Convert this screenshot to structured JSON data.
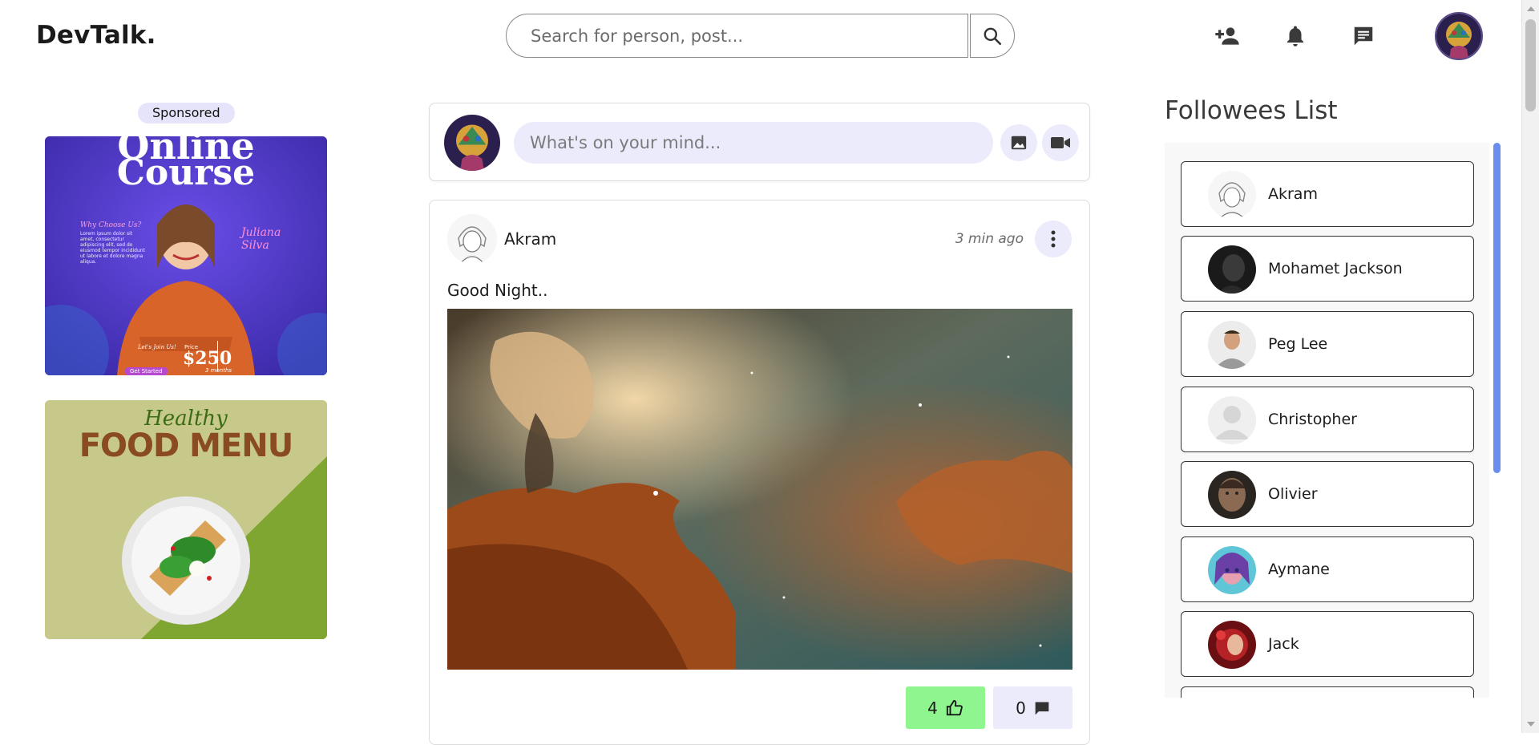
{
  "header": {
    "logo": "DevTalk.",
    "search_placeholder": "Search for person, post...",
    "icons": [
      "search-icon",
      "add-person-icon",
      "bell-icon",
      "chat-icon"
    ]
  },
  "ads": {
    "sponsored_label": "Sponsored",
    "ad1": {
      "headline1": "Online",
      "headline2": "Course",
      "why": "Why Choose Us?",
      "blurb": "Lorem ipsum dolor sit amet, consectetur adipiscing elit, sed do eiusmod tempor incididunt ut labore et dolore magna aliqua.",
      "name1": "Juliana",
      "name2": "Silva",
      "join": "Let's Join Us!",
      "price_label": "Price",
      "price": "$250",
      "duration": "3 months",
      "cta": "Get Started"
    },
    "ad2": {
      "headline1": "Healthy",
      "headline2": "FOOD MENU"
    }
  },
  "composer": {
    "placeholder": "What's on your mind..."
  },
  "post": {
    "author": "Akram",
    "time": "3 min ago",
    "text": "Good Night..",
    "likes": "4",
    "comments": "0"
  },
  "followees": {
    "title": "Followees List",
    "items": [
      {
        "name": "Akram"
      },
      {
        "name": "Mohamet Jackson"
      },
      {
        "name": "Peg Lee"
      },
      {
        "name": "Christopher"
      },
      {
        "name": "Olivier"
      },
      {
        "name": "Aymane"
      },
      {
        "name": "Jack"
      }
    ]
  },
  "colors": {
    "accent": "#6a8ef0",
    "soft_purple": "#ecebfb",
    "like_green": "#8ff58f"
  }
}
